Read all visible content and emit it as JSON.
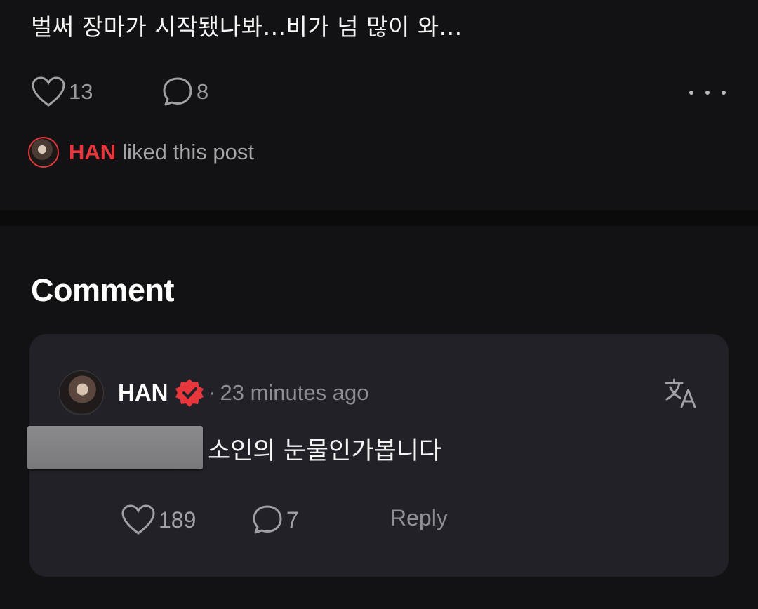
{
  "post": {
    "text": "벌써 장마가 시작됐나봐...비가 넘 많이 와...",
    "like_count": "13",
    "comment_count": "8",
    "liked_by_name": "HAN",
    "liked_by_suffix": "liked this post"
  },
  "comments_section": {
    "title": "Comment",
    "comment": {
      "author": "HAN",
      "separator": "·",
      "time": "23 minutes ago",
      "text": "소인의 눈물인가봅니다",
      "like_count": "189",
      "reply_count": "7",
      "reply_label": "Reply"
    }
  },
  "colors": {
    "background": "#121214",
    "card": "#212127",
    "accent_red": "#e8363d",
    "muted_text": "#8e8e94"
  },
  "icons": [
    "heart-icon",
    "speech-bubble-icon",
    "more-dots-icon",
    "verified-badge-icon",
    "translate-icon"
  ]
}
